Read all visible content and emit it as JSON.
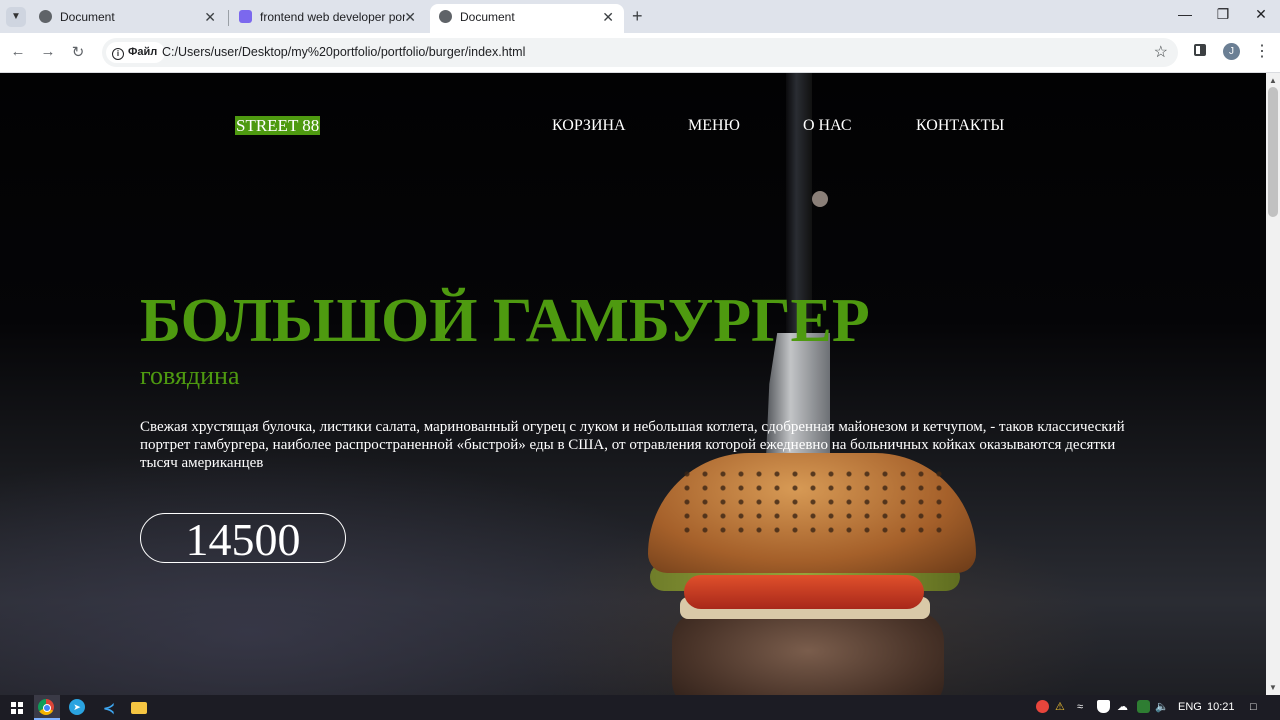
{
  "browser": {
    "tabs": [
      {
        "title": "Document",
        "active": false
      },
      {
        "title": "frontend web developer portfol",
        "active": false
      },
      {
        "title": "Document",
        "active": true
      }
    ],
    "new_tab_label": "+",
    "url_chip_label": "Файл",
    "url": "C:/Users/user/Desktop/my%20portfolio/portfolio/burger/index.html",
    "profile_initial": "J"
  },
  "site": {
    "logo": "STREET 88",
    "nav": [
      "КОРЗИНА",
      "МЕНЮ",
      "О НАС",
      "КОНТАКТЫ"
    ],
    "hero": {
      "title": "БОЛЬШОЙ ГАМБУРГЕР",
      "subtitle": "говядина",
      "description": "Свежая хрустящая булочка, листики салата, маринованный огурец с луком и небольшая котлета, сдобренная майонезом и кетчупом, - таков классический портрет гамбургера, наиболее распространенной «быстрой» еды в США, от отравления которой ежедневно на больничных койках оказываются десятки тысяч американцев",
      "price": "14500"
    },
    "colors": {
      "accent": "#4e9a10",
      "text": "#ffffff"
    }
  },
  "taskbar": {
    "language": "ENG",
    "time": "10:21"
  }
}
